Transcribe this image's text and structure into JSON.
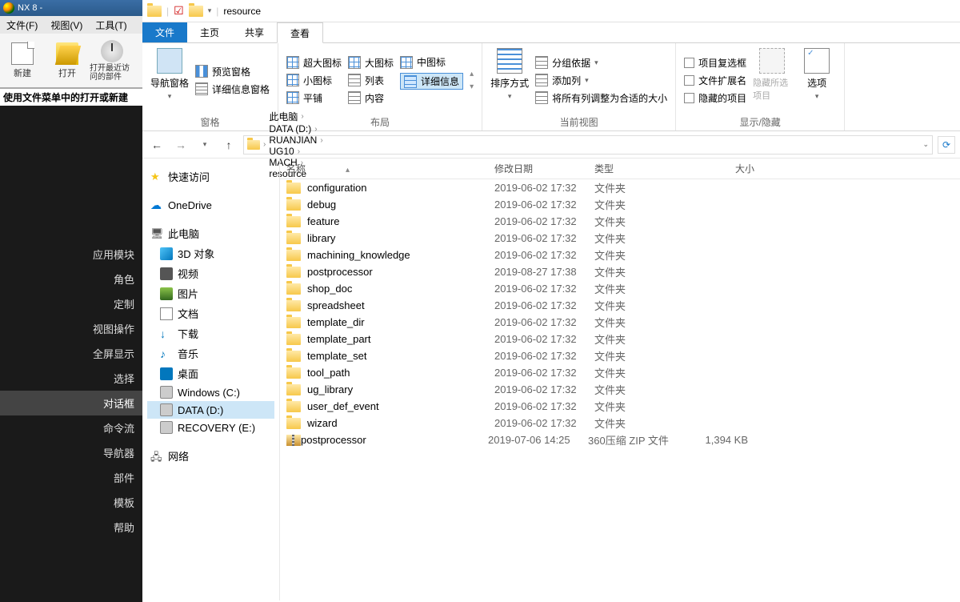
{
  "nx": {
    "title": "NX 8 -",
    "menu": [
      "文件(F)",
      "视图(V)",
      "工具(T)"
    ],
    "tools": [
      {
        "label": "新建"
      },
      {
        "label": "打开"
      },
      {
        "label": "打开最近访问的部件"
      }
    ],
    "hint": "使用文件菜单中的打开或新建",
    "sideitems": [
      "应用模块",
      "角色",
      "定制",
      "视图操作",
      "全屏显示",
      "选择",
      "对话框",
      "命令流",
      "导航器",
      "部件",
      "模板",
      "帮助"
    ],
    "side_selected_index": 6
  },
  "explorer": {
    "title_folder": "resource",
    "tabs": {
      "file": "文件",
      "home": "主页",
      "share": "共享",
      "view": "查看"
    },
    "ribbon": {
      "g1": {
        "nav": "导航窗格",
        "preview": "预览窗格",
        "details": "详细信息窗格",
        "label": "窗格"
      },
      "g2": {
        "xl": "超大图标",
        "lg": "大图标",
        "md": "中图标",
        "sm": "小图标",
        "list": "列表",
        "detail": "详细信息",
        "tile": "平铺",
        "content": "内容",
        "label": "布局"
      },
      "g3": {
        "sort": "排序方式",
        "group": "分组依据",
        "addcol": "添加列",
        "fit": "将所有列调整为合适的大小",
        "label": "当前视图"
      },
      "g4": {
        "chk": "项目复选框",
        "ext": "文件扩展名",
        "hid": "隐藏的项目",
        "hide": "隐藏所选项目",
        "opts": "选项",
        "label": "显示/隐藏"
      }
    },
    "breadcrumbs": [
      "此电脑",
      "DATA (D:)",
      "RUANJIAN",
      "UG10",
      "MACH",
      "resource"
    ],
    "navpane": {
      "quick": "快速访问",
      "onedrive": "OneDrive",
      "thispc": "此电脑",
      "pc_items": [
        {
          "ic": "3d",
          "label": "3D 对象"
        },
        {
          "ic": "video",
          "label": "视频"
        },
        {
          "ic": "pic",
          "label": "图片"
        },
        {
          "ic": "doc",
          "label": "文档"
        },
        {
          "ic": "dl",
          "label": "下载"
        },
        {
          "ic": "music",
          "label": "音乐"
        },
        {
          "ic": "desk",
          "label": "桌面"
        },
        {
          "ic": "drive",
          "label": "Windows (C:)"
        },
        {
          "ic": "drive",
          "label": "DATA (D:)"
        },
        {
          "ic": "drive",
          "label": "RECOVERY (E:)"
        }
      ],
      "selected_pc_index": 8,
      "network": "网络"
    },
    "columns": {
      "name": "名称",
      "date": "修改日期",
      "type": "类型",
      "size": "大小"
    },
    "files": [
      {
        "name": "configuration",
        "date": "2019-06-02 17:32",
        "type": "文件夹",
        "size": "",
        "icon": "folder"
      },
      {
        "name": "debug",
        "date": "2019-06-02 17:32",
        "type": "文件夹",
        "size": "",
        "icon": "folder"
      },
      {
        "name": "feature",
        "date": "2019-06-02 17:32",
        "type": "文件夹",
        "size": "",
        "icon": "folder"
      },
      {
        "name": "library",
        "date": "2019-06-02 17:32",
        "type": "文件夹",
        "size": "",
        "icon": "folder"
      },
      {
        "name": "machining_knowledge",
        "date": "2019-06-02 17:32",
        "type": "文件夹",
        "size": "",
        "icon": "folder"
      },
      {
        "name": "postprocessor",
        "date": "2019-08-27 17:38",
        "type": "文件夹",
        "size": "",
        "icon": "folder"
      },
      {
        "name": "shop_doc",
        "date": "2019-06-02 17:32",
        "type": "文件夹",
        "size": "",
        "icon": "folder"
      },
      {
        "name": "spreadsheet",
        "date": "2019-06-02 17:32",
        "type": "文件夹",
        "size": "",
        "icon": "folder"
      },
      {
        "name": "template_dir",
        "date": "2019-06-02 17:32",
        "type": "文件夹",
        "size": "",
        "icon": "folder"
      },
      {
        "name": "template_part",
        "date": "2019-06-02 17:32",
        "type": "文件夹",
        "size": "",
        "icon": "folder"
      },
      {
        "name": "template_set",
        "date": "2019-06-02 17:32",
        "type": "文件夹",
        "size": "",
        "icon": "folder"
      },
      {
        "name": "tool_path",
        "date": "2019-06-02 17:32",
        "type": "文件夹",
        "size": "",
        "icon": "folder"
      },
      {
        "name": "ug_library",
        "date": "2019-06-02 17:32",
        "type": "文件夹",
        "size": "",
        "icon": "folder"
      },
      {
        "name": "user_def_event",
        "date": "2019-06-02 17:32",
        "type": "文件夹",
        "size": "",
        "icon": "folder"
      },
      {
        "name": "wizard",
        "date": "2019-06-02 17:32",
        "type": "文件夹",
        "size": "",
        "icon": "folder"
      },
      {
        "name": "postprocessor",
        "date": "2019-07-06 14:25",
        "type": "360压缩 ZIP 文件",
        "size": "1,394 KB",
        "icon": "zip"
      }
    ]
  }
}
